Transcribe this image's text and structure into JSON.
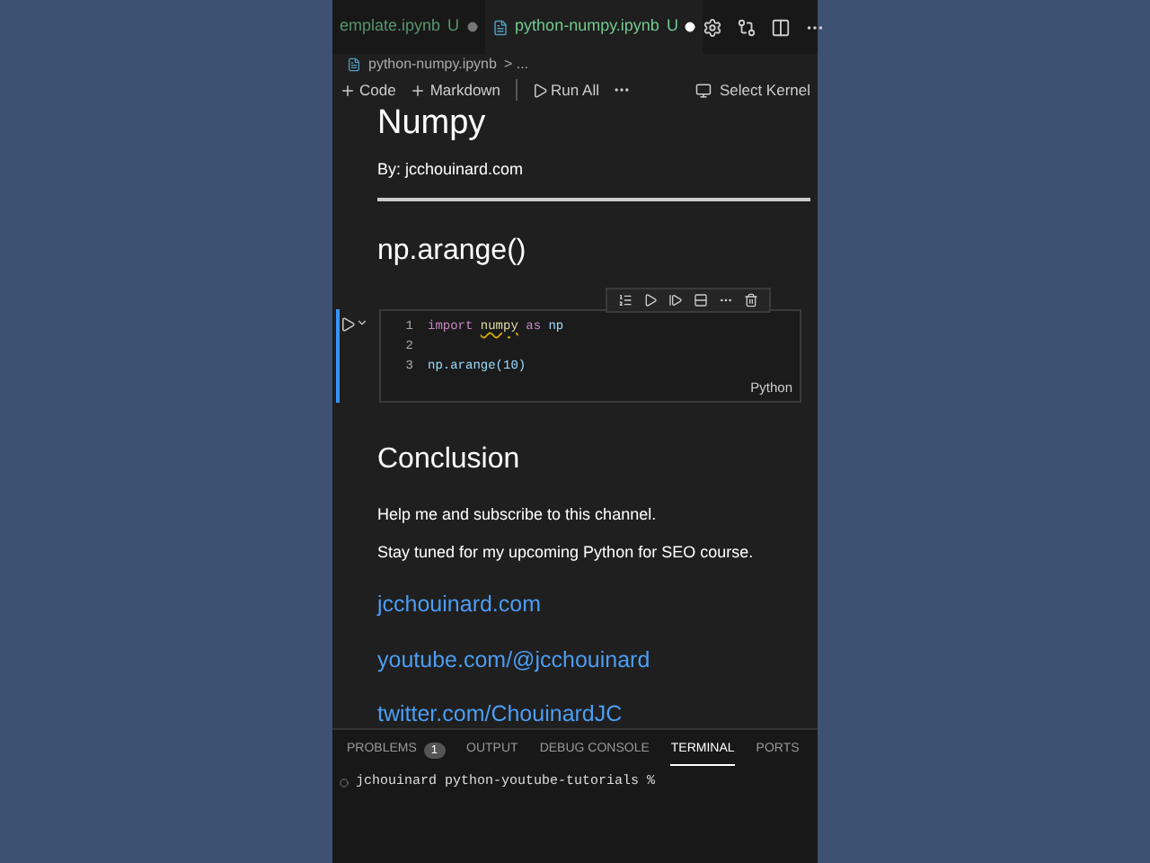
{
  "tabs": [
    {
      "label": "emplate.ipynb",
      "badge": "U",
      "selected": false
    },
    {
      "label": "python-numpy.ipynb",
      "badge": "U",
      "selected": true
    }
  ],
  "breadcrumb": {
    "file": "python-numpy.ipynb",
    "rest": "> ..."
  },
  "toolbar": {
    "code": "Code",
    "markdown": "Markdown",
    "run_all": "Run All",
    "kernel": "Select Kernel"
  },
  "notebook": {
    "title": "Numpy",
    "byline": "By: jcchouinard.com",
    "heading": "np.arange()",
    "cell": {
      "selected": true,
      "language": "Python",
      "lines": [
        {
          "number": "1",
          "tokens": [
            {
              "text": "import ",
              "kind": "keyword"
            },
            {
              "text": "numpy",
              "kind": "warn"
            },
            {
              "text": " as ",
              "kind": "keyword"
            },
            {
              "text": "np",
              "kind": "name"
            }
          ]
        },
        {
          "number": "2"
        },
        {
          "number": "3",
          "tokens": [
            {
              "text": "np.arange(10)",
              "kind": "name"
            }
          ]
        }
      ]
    },
    "heading2": "Conclusion",
    "paragraphs": [
      "Help me and subscribe to this channel.",
      "Stay tuned for my upcoming Python for SEO course."
    ],
    "links": [
      "jcchouinard.com",
      "youtube.com/@jcchouinard",
      "twitter.com/ChouinardJC"
    ]
  },
  "panel": {
    "tabs": [
      {
        "label": "PROBLEMS",
        "count": "1",
        "selected": false
      },
      {
        "label": "OUTPUT",
        "selected": false
      },
      {
        "label": "DEBUG CONSOLE",
        "selected": false
      },
      {
        "label": "TERMINAL",
        "selected": true
      },
      {
        "label": "PORTS",
        "selected": false
      }
    ],
    "prompt": "jchouinard python-youtube-tutorials %"
  }
}
